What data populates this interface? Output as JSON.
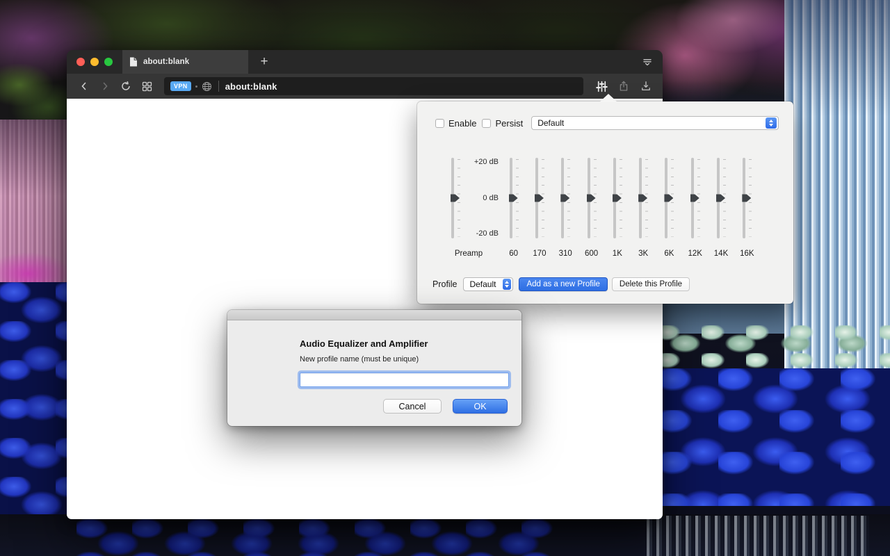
{
  "theme": {
    "accent_blue": "#2f6fe4",
    "vpn_badge_blue": "#58a9f3",
    "traffic_red": "#ff5f57",
    "traffic_yellow": "#febc2e",
    "traffic_green": "#28c840"
  },
  "browser": {
    "tab": {
      "title": "about:blank"
    },
    "new_tab_label": "+",
    "address_bar": {
      "vpn_label": "VPN",
      "url": "about:blank"
    }
  },
  "popup": {
    "enable_label": "Enable",
    "persist_label": "Persist",
    "preset_select_value": "Default",
    "equalizer": {
      "scale_top": "+20 dB",
      "scale_mid": "0 dB",
      "scale_bottom": "-20 dB",
      "preamp_label": "Preamp",
      "preamp_db": 0,
      "bands": [
        "60",
        "170",
        "310",
        "600",
        "1K",
        "3K",
        "6K",
        "12K",
        "14K",
        "16K"
      ],
      "band_values_db": [
        0,
        0,
        0,
        0,
        0,
        0,
        0,
        0,
        0,
        0
      ]
    },
    "profile_row": {
      "label": "Profile",
      "select_value": "Default",
      "add_button": "Add as a new Profile",
      "delete_button": "Delete this Profile"
    }
  },
  "dialog": {
    "title": "Audio Equalizer and Amplifier",
    "subtitle": "New profile name (must be unique)",
    "input_value": "",
    "cancel_label": "Cancel",
    "ok_label": "OK"
  }
}
